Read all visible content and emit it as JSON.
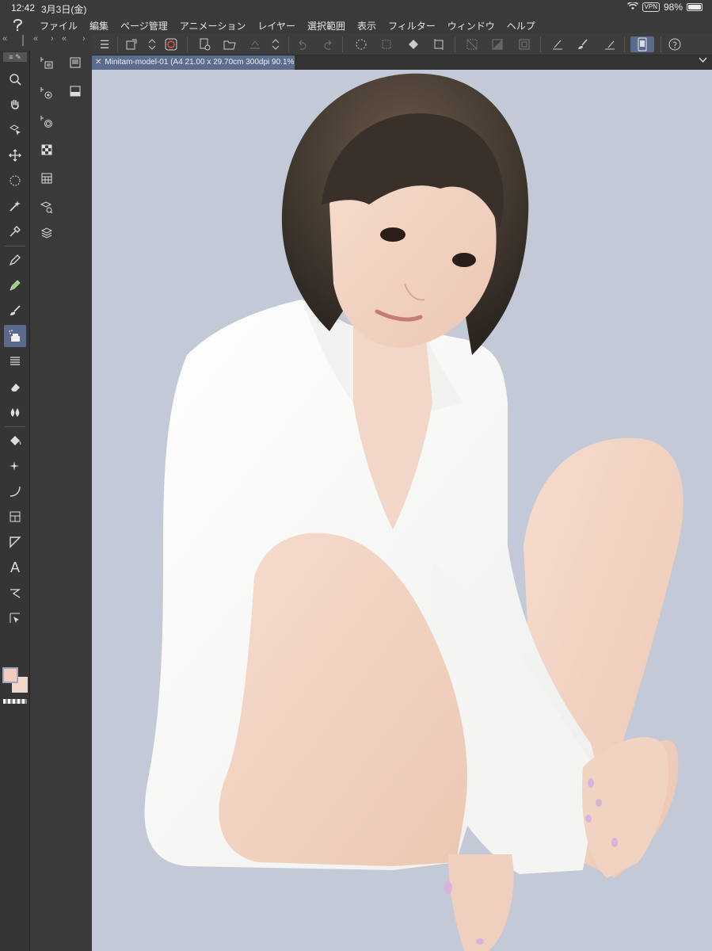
{
  "status": {
    "time": "12:42",
    "date": "3月3日(金)",
    "vpn": "VPN",
    "battery": "98%",
    "battery_level": 0.98
  },
  "menu": {
    "items": [
      "ファイル",
      "編集",
      "ページ管理",
      "アニメーション",
      "レイヤー",
      "選択範囲",
      "表示",
      "フィルター",
      "ウィンドウ",
      "ヘルプ"
    ]
  },
  "tab": {
    "close": "✕",
    "title": "Minitam-model-01 (A4 21.00 x 29.70cm 300dpi 90.1%)"
  },
  "tools": {
    "text_glyph": "A"
  },
  "colors": {
    "main": "#f3cdbb",
    "sub": "#f3d6c6",
    "canvas_bg": "#c3c9d6",
    "accent": "#5b6c8f"
  }
}
